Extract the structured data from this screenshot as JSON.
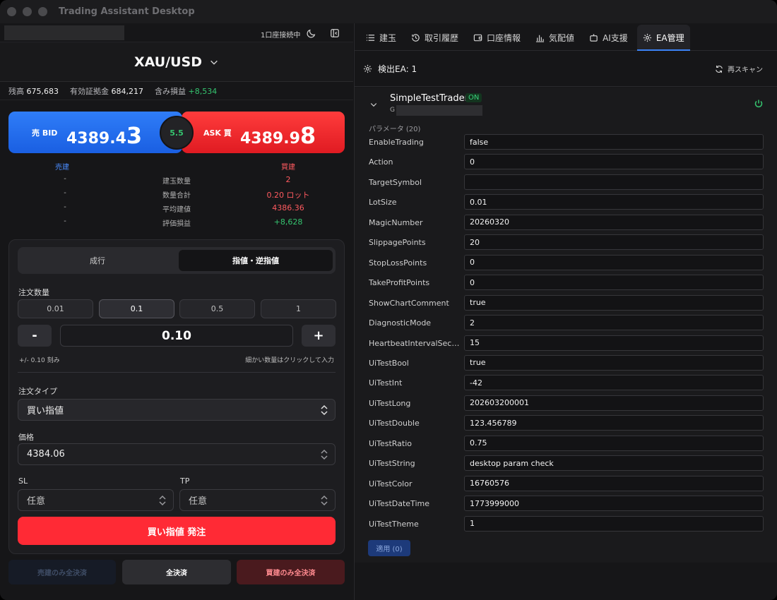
{
  "window": {
    "title": "Trading Assistant Desktop"
  },
  "header": {
    "connection_status": "1口座接続中"
  },
  "symbol": {
    "name": "XAU/USD"
  },
  "account": {
    "balance_label": "残高",
    "balance": "675,683",
    "equity_label": "有効証拠金",
    "equity": "684,217",
    "pnl_label": "含み損益",
    "pnl": "+8,534"
  },
  "prices": {
    "bid_label": "売 BID",
    "bid_main": "4389.4",
    "bid_last": "3",
    "ask_label": "ASK 買",
    "ask_main": "4389.9",
    "ask_last": "8",
    "spread": "5.5"
  },
  "positions": {
    "sell_header": "売建",
    "buy_header": "買建",
    "rows": [
      {
        "label": "建玉数量",
        "sell": "-",
        "buy": "2"
      },
      {
        "label": "数量合計",
        "sell": "-",
        "buy": "0.20 ロット"
      },
      {
        "label": "平均建値",
        "sell": "-",
        "buy": "4386.36"
      },
      {
        "label": "評価損益",
        "sell": "-",
        "buy": "+8,628"
      }
    ]
  },
  "order": {
    "tab_market": "成行",
    "tab_limit": "指値・逆指値",
    "qty_label": "注文数量",
    "qty_presets": [
      "0.01",
      "0.1",
      "0.5",
      "1"
    ],
    "qty_minus": "-",
    "qty_plus": "+",
    "qty_value": "0.10",
    "step_hint": "+/- 0.10 刻み",
    "fine_hint": "細かい数量はクリックして入力",
    "type_label": "注文タイプ",
    "type_value": "買い指値",
    "price_label": "価格",
    "price_value": "4384.06",
    "sl_label": "SL",
    "sl_placeholder": "任意",
    "tp_label": "TP",
    "tp_placeholder": "任意",
    "submit": "買い指値 発注"
  },
  "close_buttons": {
    "sell_only": "売建のみ全決済",
    "all": "全決済",
    "buy_only": "買建のみ全決済"
  },
  "tabs": [
    {
      "label": "建玉",
      "icon": "list-icon"
    },
    {
      "label": "取引履歴",
      "icon": "history-icon"
    },
    {
      "label": "口座情報",
      "icon": "wallet-icon"
    },
    {
      "label": "気配値",
      "icon": "bar-chart-icon"
    },
    {
      "label": "AI支援",
      "icon": "robot-icon"
    },
    {
      "label": "EA管理",
      "icon": "gear-icon"
    }
  ],
  "ea": {
    "detected": "検出EA: 1",
    "rescan": "再スキャン",
    "name": "SimpleTestTrader",
    "status": "ON",
    "sub_prefix": "G",
    "params_header": "パラメータ (20)",
    "params": [
      {
        "name": "EnableTrading",
        "value": "false"
      },
      {
        "name": "Action",
        "value": "0"
      },
      {
        "name": "TargetSymbol",
        "value": ""
      },
      {
        "name": "LotSize",
        "value": "0.01"
      },
      {
        "name": "MagicNumber",
        "value": "20260320"
      },
      {
        "name": "SlippagePoints",
        "value": "20"
      },
      {
        "name": "StopLossPoints",
        "value": "0"
      },
      {
        "name": "TakeProfitPoints",
        "value": "0"
      },
      {
        "name": "ShowChartComment",
        "value": "true"
      },
      {
        "name": "DiagnosticMode",
        "value": "2"
      },
      {
        "name": "HeartbeatIntervalSeco…",
        "value": "15"
      },
      {
        "name": "UiTestBool",
        "value": "true"
      },
      {
        "name": "UiTestInt",
        "value": "-42"
      },
      {
        "name": "UiTestLong",
        "value": "202603200001"
      },
      {
        "name": "UiTestDouble",
        "value": "123.456789"
      },
      {
        "name": "UiTestRatio",
        "value": "0.75"
      },
      {
        "name": "UiTestString",
        "value": "desktop param check"
      },
      {
        "name": "UiTestColor",
        "value": "16760576"
      },
      {
        "name": "UiTestDateTime",
        "value": "1773999000"
      },
      {
        "name": "UiTestTheme",
        "value": "1"
      }
    ],
    "apply": "適用 (0)"
  },
  "colors": {
    "bid": "#1a5fe2",
    "ask": "#e01b22",
    "profit": "#35c46f",
    "accent": "#3b82f6"
  }
}
